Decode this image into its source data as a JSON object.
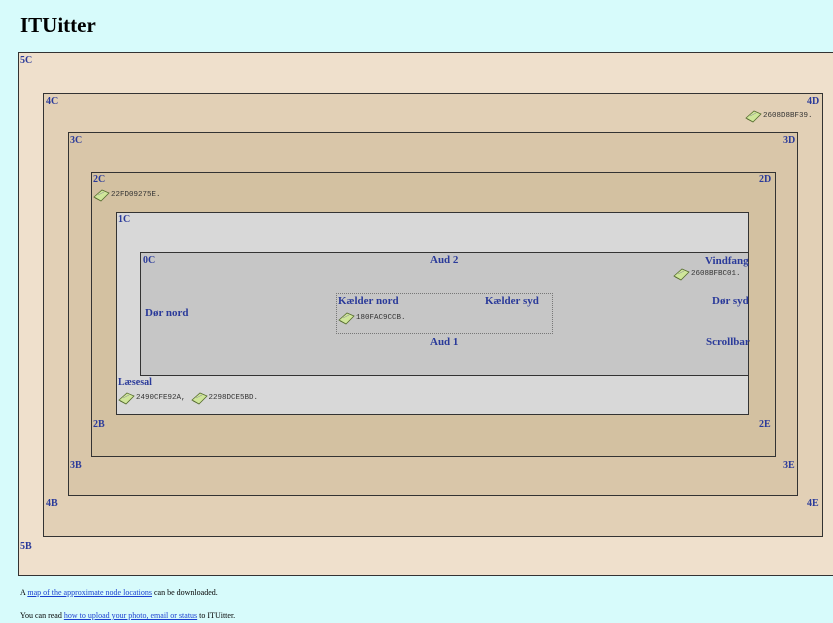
{
  "page": {
    "title": "ITUitter"
  },
  "zones": {
    "5C": "5C",
    "5B": "5B",
    "4C": "4C",
    "4D": "4D",
    "4B": "4B",
    "4E": "4E",
    "3C": "3C",
    "3D": "3D",
    "3B": "3B",
    "3E": "3E",
    "2C": "2C",
    "2D": "2D",
    "2B": "2B",
    "2E": "2E",
    "1C": "1C",
    "laesesal": "Læsesal",
    "0C": "0C",
    "aud2": "Aud 2",
    "aud1": "Aud 1",
    "vindfang": "Vindfang",
    "dor_syd": "Dør syd",
    "dor_nord": "Dør nord",
    "scrollbar": "Scrollbar",
    "kaelder_nord": "Kælder nord",
    "kaelder_syd": "Kælder syd"
  },
  "nodes": {
    "n4d": "2608D8BF39.",
    "n2c": "22FD09275E.",
    "nvindfang": "2608BFBC01.",
    "nkaelder": "180FAC9CCB.",
    "nlaesesal1": "2490CFE92A,",
    "nlaesesal2": "2298DCE5BD."
  },
  "footer": {
    "line1_prefix": "A",
    "line1_link": "map of the approximate node locations",
    "line1_suffix": "can be downloaded.",
    "line2_prefix": "You can read",
    "line2_link": "how to upload your photo, email or status",
    "line2_suffix": "to ITUitter."
  },
  "colors": {
    "background": "#d7fbfb",
    "label_blue": "#2a3a9a",
    "link": "#1a3fd0",
    "level5": "#efe0cc",
    "level4": "#e2d0b6",
    "level3": "#d9c6a9",
    "level2": "#d3c1a1",
    "level1": "#d8d8d8",
    "level0": "#c6c6c6"
  },
  "icons": {
    "node": "book-icon"
  }
}
